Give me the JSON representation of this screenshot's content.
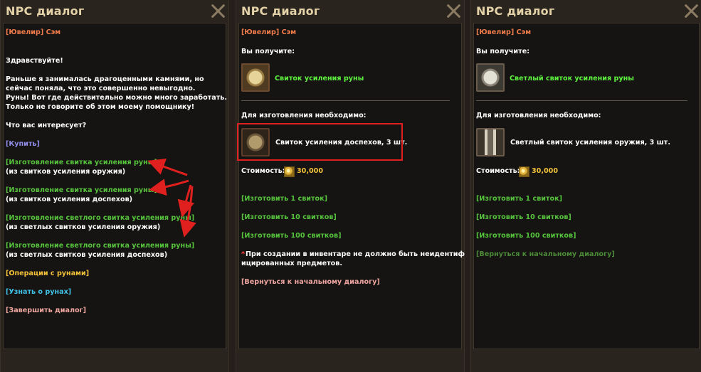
{
  "window1": {
    "title": "NPC диалог",
    "npc_name": "[Ювелир] Сэм",
    "greeting": "Здравствуйте!",
    "body_lines": [
      "Раньше я занималась драгоценными камнями, но",
      "сейчас поняла, что это совершенно невыгодно.",
      "Руны! Вот где действительно можно много заработать.",
      "Только не говорите об этом моему помощнику!"
    ],
    "question": "Что вас интересует?",
    "buy_link": "[Купить]",
    "craft_options": [
      {
        "label": "[Изготовление свитка усиления руны]",
        "sub": "(из свитков усиления оружия)"
      },
      {
        "label": "[Изготовление свитка усиления руны]",
        "sub": "(из свитков усиления доспехов)"
      },
      {
        "label": "[Изготовление светлого свитка усиления руны]",
        "sub": "(из светлых свитков усиления оружия)"
      },
      {
        "label": "[Изготовление светлого свитка усиления руны]",
        "sub": "(из светлых свитков усиления доспехов)"
      }
    ],
    "rune_ops": "[Операции с рунами]",
    "learn_runes": "[Узнать о рунах]",
    "end_dialog": "[Завершить диалог]"
  },
  "window2": {
    "title": "NPC диалог",
    "npc_name": "[Ювелир] Сэм",
    "receive_label": "Вы получите:",
    "reward_item": "Свиток усиления руны",
    "required_label": "Для изготовления необходимо:",
    "required_item": "Свиток усиления доспехов, 3 шт.",
    "cost_label": "Стоимость:",
    "cost_value": "30,000",
    "craft_1": "[Изготовить 1 свиток]",
    "craft_10": "[Изготовить 10 свитков]",
    "craft_100": "[Изготовить 100 свитков]",
    "note_marker": "*",
    "note_line1": "При создании в инвентаре не должно быть неидентиф",
    "note_line2": "ицированных предметов.",
    "back_link": "[Вернуться к начальному диалогу]"
  },
  "window3": {
    "title": "NPC диалог",
    "npc_name": "[Ювелир] Сэм",
    "receive_label": "Вы получите:",
    "reward_item": "Светлый свиток усиления руны",
    "required_label": "Для изготовления необходимо:",
    "required_item": "Светлый свиток усиления оружия, 3 шт.",
    "cost_label": "Стоимость:",
    "cost_value": "30,000",
    "craft_1": "[Изготовить 1 свиток]",
    "craft_10": "[Изготовить 10 свитков]",
    "craft_100": "[Изготовить 100 свитков]",
    "back_link": "[Вернуться к начальному диалогу]"
  },
  "colors": {
    "npc_name": "#f07b4b",
    "link_green": "#56c43d",
    "buy_link": "#8f8de8",
    "rune_ops": "#f2c23a",
    "learn_runes": "#3fc3e8",
    "end_dialog": "#f0a6a0",
    "reward_item": "#5df43f",
    "highlight_box": "#e0201e",
    "annotation_arrows": "#e0201e"
  }
}
